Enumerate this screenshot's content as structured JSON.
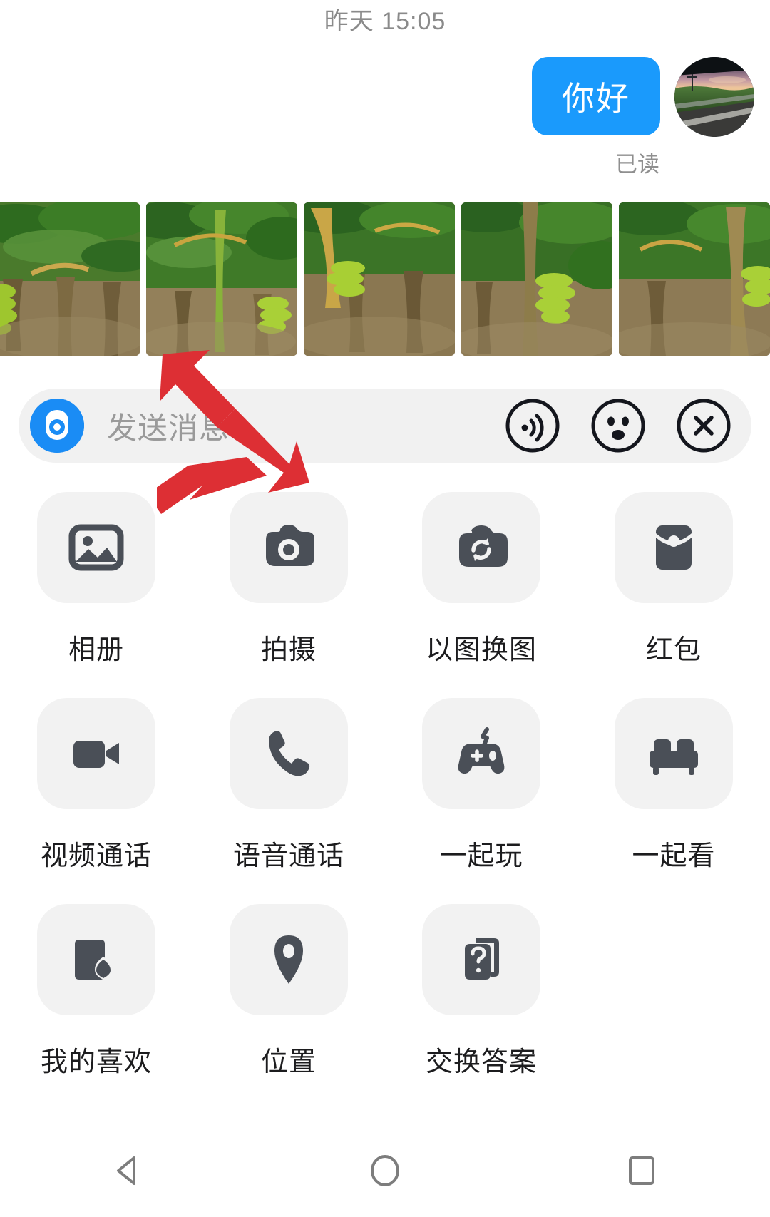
{
  "conversation": {
    "timestamp": "昨天 15:05",
    "message": {
      "text": "你好",
      "bubble_color": "#1a9afc",
      "text_color": "#ffffff"
    },
    "avatar_name": "avatar",
    "read_status": "已读"
  },
  "photo_strip": {
    "name": "photo-strip",
    "count": 5,
    "photos": [
      {
        "alt": "banana-plantation-photo-1"
      },
      {
        "alt": "banana-plantation-photo-2"
      },
      {
        "alt": "banana-plantation-photo-3"
      },
      {
        "alt": "banana-plantation-photo-4"
      },
      {
        "alt": "banana-plantation-photo-5"
      }
    ]
  },
  "input_bar": {
    "placeholder": "发送消息",
    "voice_icon": "voice-record-icon",
    "accent_color": "#1a8cf5",
    "background_color": "#f1f1f1",
    "actions": [
      {
        "icon": "voice-wave-icon",
        "name": "voice-message-button"
      },
      {
        "icon": "emoji-face-icon",
        "name": "emoji-button"
      },
      {
        "icon": "close-x-icon",
        "name": "close-panel-button"
      }
    ]
  },
  "app_grid": {
    "items": [
      {
        "label": "相册",
        "icon": "photo-album-icon"
      },
      {
        "label": "拍摄",
        "icon": "camera-icon"
      },
      {
        "label": "以图换图",
        "icon": "image-swap-icon"
      },
      {
        "label": "红包",
        "icon": "red-packet-icon"
      },
      {
        "label": "视频通话",
        "icon": "video-call-icon"
      },
      {
        "label": "语音通话",
        "icon": "phone-call-icon"
      },
      {
        "label": "一起玩",
        "icon": "gamepad-icon"
      },
      {
        "label": "一起看",
        "icon": "sofa-icon"
      },
      {
        "label": "我的喜欢",
        "icon": "my-favorites-heart-icon"
      },
      {
        "label": "位置",
        "icon": "location-pin-icon"
      },
      {
        "label": "交换答案",
        "icon": "question-cards-icon"
      }
    ]
  },
  "annotation": {
    "name": "red-double-arrow",
    "color": "#dd2f34"
  },
  "navbar": {
    "buttons": [
      {
        "name": "back-button",
        "icon": "triangle-back-icon"
      },
      {
        "name": "home-button",
        "icon": "circle-home-icon"
      },
      {
        "name": "recents-button",
        "icon": "square-recents-icon"
      }
    ]
  }
}
